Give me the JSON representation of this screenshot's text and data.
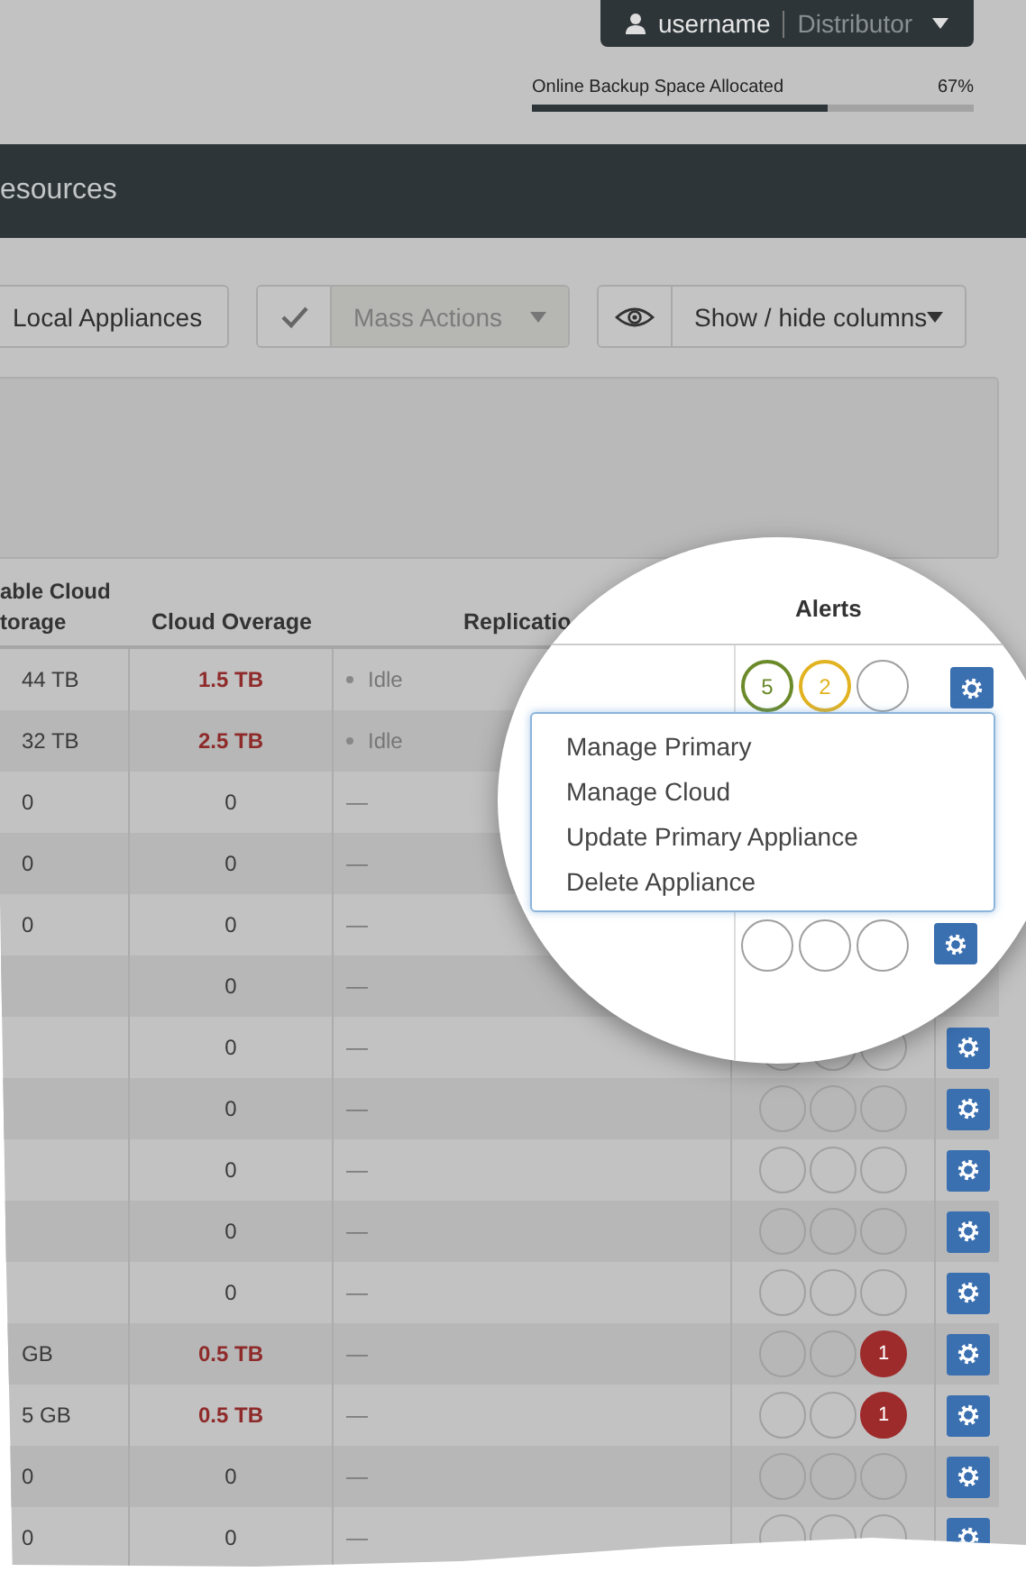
{
  "account": {
    "username": "username",
    "role": "Distributor"
  },
  "storage": {
    "label": "Online Backup Space Allocated",
    "reading": "67%",
    "level": 0.67
  },
  "header": {
    "title": "esources"
  },
  "toolbar": {
    "local_appliances": "Local Appliances",
    "mass_actions": {
      "label": "Mass Actions",
      "disabled": true
    },
    "columns_toggle": "Show / hide columns"
  },
  "table": {
    "columns": [
      "able Cloud\ntorage",
      "Cloud Overage",
      "Replicatio"
    ],
    "rows": [
      {
        "column_1": "44 TB",
        "overage": "1.5 TB",
        "exceeded": true,
        "replication": "Idle",
        "dot": true
      },
      {
        "column_1": "32 TB",
        "overage": "2.5 TB",
        "exceeded": true,
        "replication": "Idle",
        "dot": true
      },
      {
        "column_1": "0",
        "overage": "0",
        "exceeded": false,
        "replication": "—",
        "dot": false
      },
      {
        "column_1": "0",
        "overage": "0",
        "exceeded": false,
        "replication": "—",
        "dot": false
      },
      {
        "column_1": "0",
        "overage": "0",
        "exceeded": false,
        "replication": "—",
        "dot": false
      },
      {
        "overage": "0",
        "exceeded": false,
        "replication": "—",
        "dot": false
      },
      {
        "overage": "0",
        "exceeded": false,
        "replication": "—",
        "dot": false,
        "settings_button": true,
        "alerts": [
          {
            "kind": "empty"
          },
          {
            "kind": "empty"
          },
          {
            "kind": "empty"
          }
        ]
      },
      {
        "overage": "0",
        "exceeded": false,
        "replication": "—",
        "dot": false,
        "settings_button": true,
        "alerts": [
          {
            "kind": "empty"
          },
          {
            "kind": "empty"
          },
          {
            "kind": "empty"
          }
        ]
      },
      {
        "overage": "0",
        "exceeded": false,
        "replication": "—",
        "dot": false,
        "settings_button": true,
        "alerts": [
          {
            "kind": "empty"
          },
          {
            "kind": "empty"
          },
          {
            "kind": "empty"
          }
        ]
      },
      {
        "overage": "0",
        "exceeded": false,
        "replication": "—",
        "dot": false,
        "settings_button": true,
        "alerts": [
          {
            "kind": "empty"
          },
          {
            "kind": "empty"
          },
          {
            "kind": "empty"
          }
        ]
      },
      {
        "overage": "0",
        "exceeded": false,
        "replication": "—",
        "dot": false,
        "settings_button": true,
        "alerts": [
          {
            "kind": "empty"
          },
          {
            "kind": "empty"
          },
          {
            "kind": "empty"
          }
        ]
      },
      {
        "column_1": "GB",
        "overage": "0.5 TB",
        "exceeded": true,
        "replication": "—",
        "dot": false,
        "settings_button": true,
        "alerts": [
          {
            "kind": "empty"
          },
          {
            "kind": "empty"
          },
          {
            "kind": "badge",
            "text": "1",
            "color": "#9e2b2b"
          }
        ]
      },
      {
        "column_1": "5 GB",
        "overage": "0.5 TB",
        "exceeded": true,
        "replication": "—",
        "dot": false,
        "settings_button": true,
        "alerts": [
          {
            "kind": "empty"
          },
          {
            "kind": "empty"
          },
          {
            "kind": "badge",
            "text": "1",
            "color": "#9e2b2b"
          }
        ]
      },
      {
        "column_1": "0",
        "overage": "0",
        "exceeded": false,
        "replication": "—",
        "dot": false,
        "settings_button": true,
        "alerts": [
          {
            "kind": "empty"
          },
          {
            "kind": "empty"
          },
          {
            "kind": "empty"
          }
        ]
      },
      {
        "column_1": "0",
        "overage": "0",
        "exceeded": false,
        "replication": "—",
        "dot": false,
        "settings_button": true,
        "alerts": [
          {
            "kind": "empty"
          },
          {
            "kind": "empty"
          },
          {
            "kind": "empty"
          }
        ]
      }
    ]
  },
  "magnifier": {
    "column": "Alerts",
    "rows": [
      {
        "alerts": [
          {
            "kind": "ring",
            "text": "5",
            "color": "#6b8a2a"
          },
          {
            "kind": "ring",
            "text": "2",
            "color": "#e2b321"
          },
          {
            "kind": "empty"
          }
        ]
      },
      {
        "alerts": [
          {
            "kind": "empty"
          },
          {
            "kind": "empty"
          },
          {
            "kind": "empty"
          }
        ]
      }
    ],
    "menu": [
      "Manage Primary",
      "Manage Cloud",
      "Update Primary Appliance",
      "Delete Appliance"
    ]
  }
}
